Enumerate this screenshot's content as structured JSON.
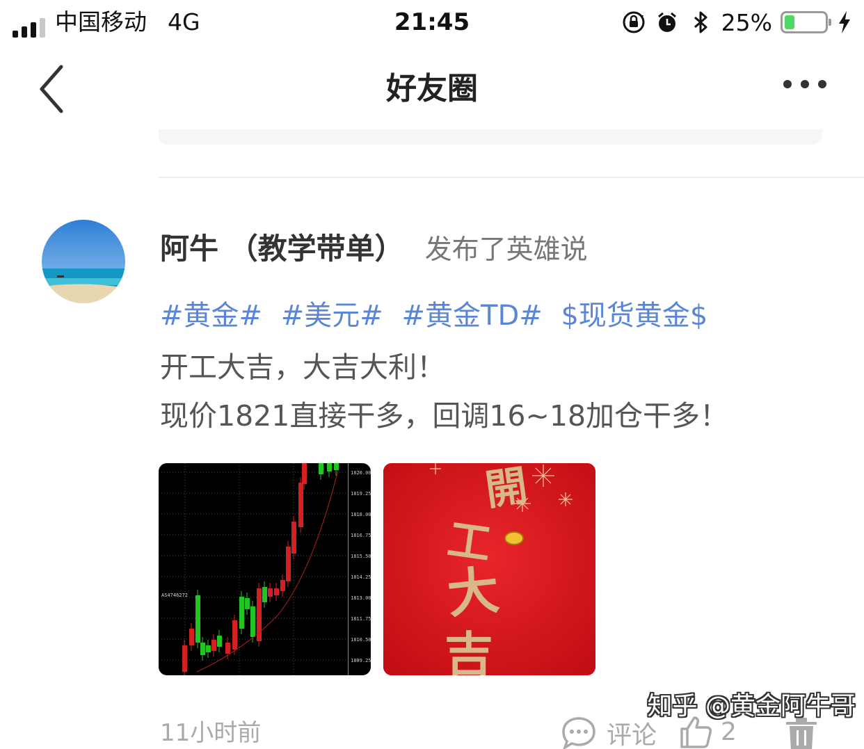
{
  "status_bar": {
    "carrier": "中国移动",
    "network": "4G",
    "time": "21:45",
    "battery_percent": "25%",
    "battery_level": 0.25,
    "icons": [
      "signal-icon",
      "orientation-lock-icon",
      "alarm-icon",
      "bluetooth-icon",
      "battery-icon",
      "charging-icon"
    ]
  },
  "navbar": {
    "title": "好友圈",
    "back_icon": "chevron-left-icon",
    "more_icon": "more-dots-icon"
  },
  "post": {
    "author": "阿牛 （教学带单）",
    "action": "发布了英雄说",
    "tags": [
      "#黄金#",
      "#美元#",
      "#黄金TD#",
      "$现货黄金$"
    ],
    "lines": [
      "开工大吉，大吉大利！",
      "现价1821直接干多，回调16~18加仓干多！"
    ],
    "images": {
      "chart_price_labels": [
        "1820.00",
        "1819.25",
        "1818.00",
        "1816.75",
        "1815.50",
        "1814.25",
        "1813.00",
        "1811.75",
        "1810.50",
        "1809.25"
      ],
      "chart_note": "AS4746272",
      "greeting_text": "開工大吉"
    },
    "time": "11小时前",
    "comment_label": "评论",
    "like_count": "2"
  },
  "watermark": "知乎 @黄金阿牛哥",
  "colors": {
    "tag_blue": "#5b86d6",
    "candle_up": "#22c522",
    "candle_down": "#d42020",
    "greeting_red": "#d8161b"
  }
}
